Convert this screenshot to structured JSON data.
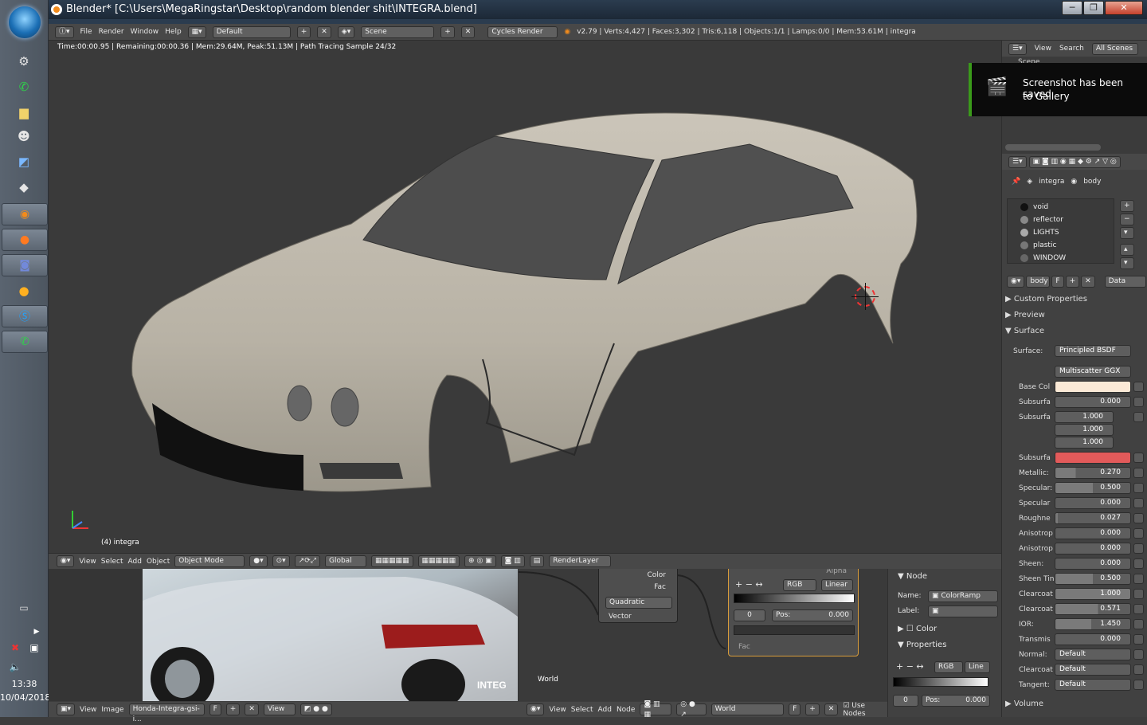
{
  "window": {
    "title": "Blender* [C:\\Users\\MegaRingstar\\Desktop\\random blender shit\\INTEGRA.blend]"
  },
  "taskbar": {
    "time": "13:38",
    "date": "10/04/2018"
  },
  "info_header": {
    "menus": [
      "File",
      "Render",
      "Window",
      "Help"
    ],
    "layout": "Default",
    "scene": "Scene",
    "engine": "Cycles Render",
    "stats": "v2.79 | Verts:4,427 | Faces:3,302 | Tris:6,118 | Objects:1/1 | Lamps:0/0 | Mem:53.61M | integra"
  },
  "viewport": {
    "render_status": "Time:00:00.95 | Remaining:00:00.36 | Mem:29.64M, Peak:51.13M | Path Tracing Sample 24/32",
    "object_label": "(4) integra",
    "header": {
      "menus": [
        "View",
        "Select",
        "Add",
        "Object"
      ],
      "mode": "Object Mode",
      "orientation": "Global",
      "render_layer": "RenderLayer"
    }
  },
  "image_editor": {
    "header": {
      "menus": [
        "View",
        "Image"
      ],
      "image_name": "Honda-Integra-gsi-i...",
      "fake_user": "F",
      "view_menu": "View"
    }
  },
  "node_editor": {
    "world_label": "World",
    "node_a": {
      "outputs": [
        "Color",
        "Fac"
      ],
      "interpolation": "Quadratic",
      "input": "Vector"
    },
    "colorramp": {
      "alpha_label": "Alpha",
      "color_mode": "RGB",
      "interpolation": "Linear",
      "index": "0",
      "pos_label": "Pos:",
      "pos_value": "0.000",
      "fac_label": "Fac"
    },
    "header": {
      "menus": [
        "View",
        "Select",
        "Add",
        "Node"
      ],
      "world": "World",
      "fake_user": "F",
      "use_nodes": "Use Nodes"
    }
  },
  "node_side": {
    "node_section": "Node",
    "name_label": "Name:",
    "name_value": "ColorRamp",
    "label_label": "Label:",
    "color_section": "Color",
    "properties_section": "Properties",
    "color_mode": "RGB",
    "interpolation": "Line",
    "index": "0",
    "pos_label": "Pos:",
    "pos_value": "0.000"
  },
  "outliner": {
    "menus": [
      "View",
      "Search"
    ],
    "filter": "All Scenes",
    "scene_item": "Scene"
  },
  "notification": {
    "line1": "Screenshot has been saved",
    "line2": "to Gallery"
  },
  "properties": {
    "breadcrumb_object": "integra",
    "breadcrumb_material": "body",
    "materials": [
      {
        "name": "void",
        "color": "#111111"
      },
      {
        "name": "reflector",
        "color": "#888888"
      },
      {
        "name": "LIGHTS",
        "color": "#aaaaaa"
      },
      {
        "name": "plastic",
        "color": "#777777"
      },
      {
        "name": "WINDOW",
        "color": "#666666"
      }
    ],
    "material_name": "body",
    "fake_user": "F",
    "link": "Data",
    "sections": {
      "custom_properties": "Custom Properties",
      "preview": "Preview",
      "surface": "Surface",
      "volume": "Volume"
    },
    "surface_label": "Surface:",
    "surface_shader": "Principled BSDF",
    "distribution": "Multiscatter GGX",
    "base_color_label": "Base Col",
    "base_color": "#fbe9d6",
    "subsurface_color": "#e25a5a",
    "subsurface_radius": [
      "1.000",
      "1.000",
      "1.000"
    ],
    "params": [
      {
        "label": "Subsurfa",
        "value": "0.000",
        "fill": 0
      },
      {
        "label": "Metallic:",
        "value": "0.270",
        "fill": 0.27
      },
      {
        "label": "Specular:",
        "value": "0.500",
        "fill": 0.5
      },
      {
        "label": "Specular",
        "value": "0.000",
        "fill": 0
      },
      {
        "label": "Roughne",
        "value": "0.027",
        "fill": 0.027
      },
      {
        "label": "Anisotrop",
        "value": "0.000",
        "fill": 0
      },
      {
        "label": "Anisotrop",
        "value": "0.000",
        "fill": 0
      },
      {
        "label": "Sheen:",
        "value": "0.000",
        "fill": 0
      },
      {
        "label": "Sheen Tin",
        "value": "0.500",
        "fill": 0.5
      },
      {
        "label": "Clearcoat",
        "value": "1.000",
        "fill": 1
      },
      {
        "label": "Clearcoat",
        "value": "0.571",
        "fill": 0.571
      },
      {
        "label": "IOR:",
        "value": "1.450",
        "fill": 0.48
      },
      {
        "label": "Transmis",
        "value": "0.000",
        "fill": 0
      }
    ],
    "subsurface_radius_label": "Subsurfa",
    "subsurface_color_label": "Subsurfa",
    "normal_label": "Normal:",
    "normal_value": "Default",
    "clearcoat_normal_label": "Clearcoat",
    "clearcoat_normal_value": "Default",
    "tangent_label": "Tangent:",
    "tangent_value": "Default"
  }
}
